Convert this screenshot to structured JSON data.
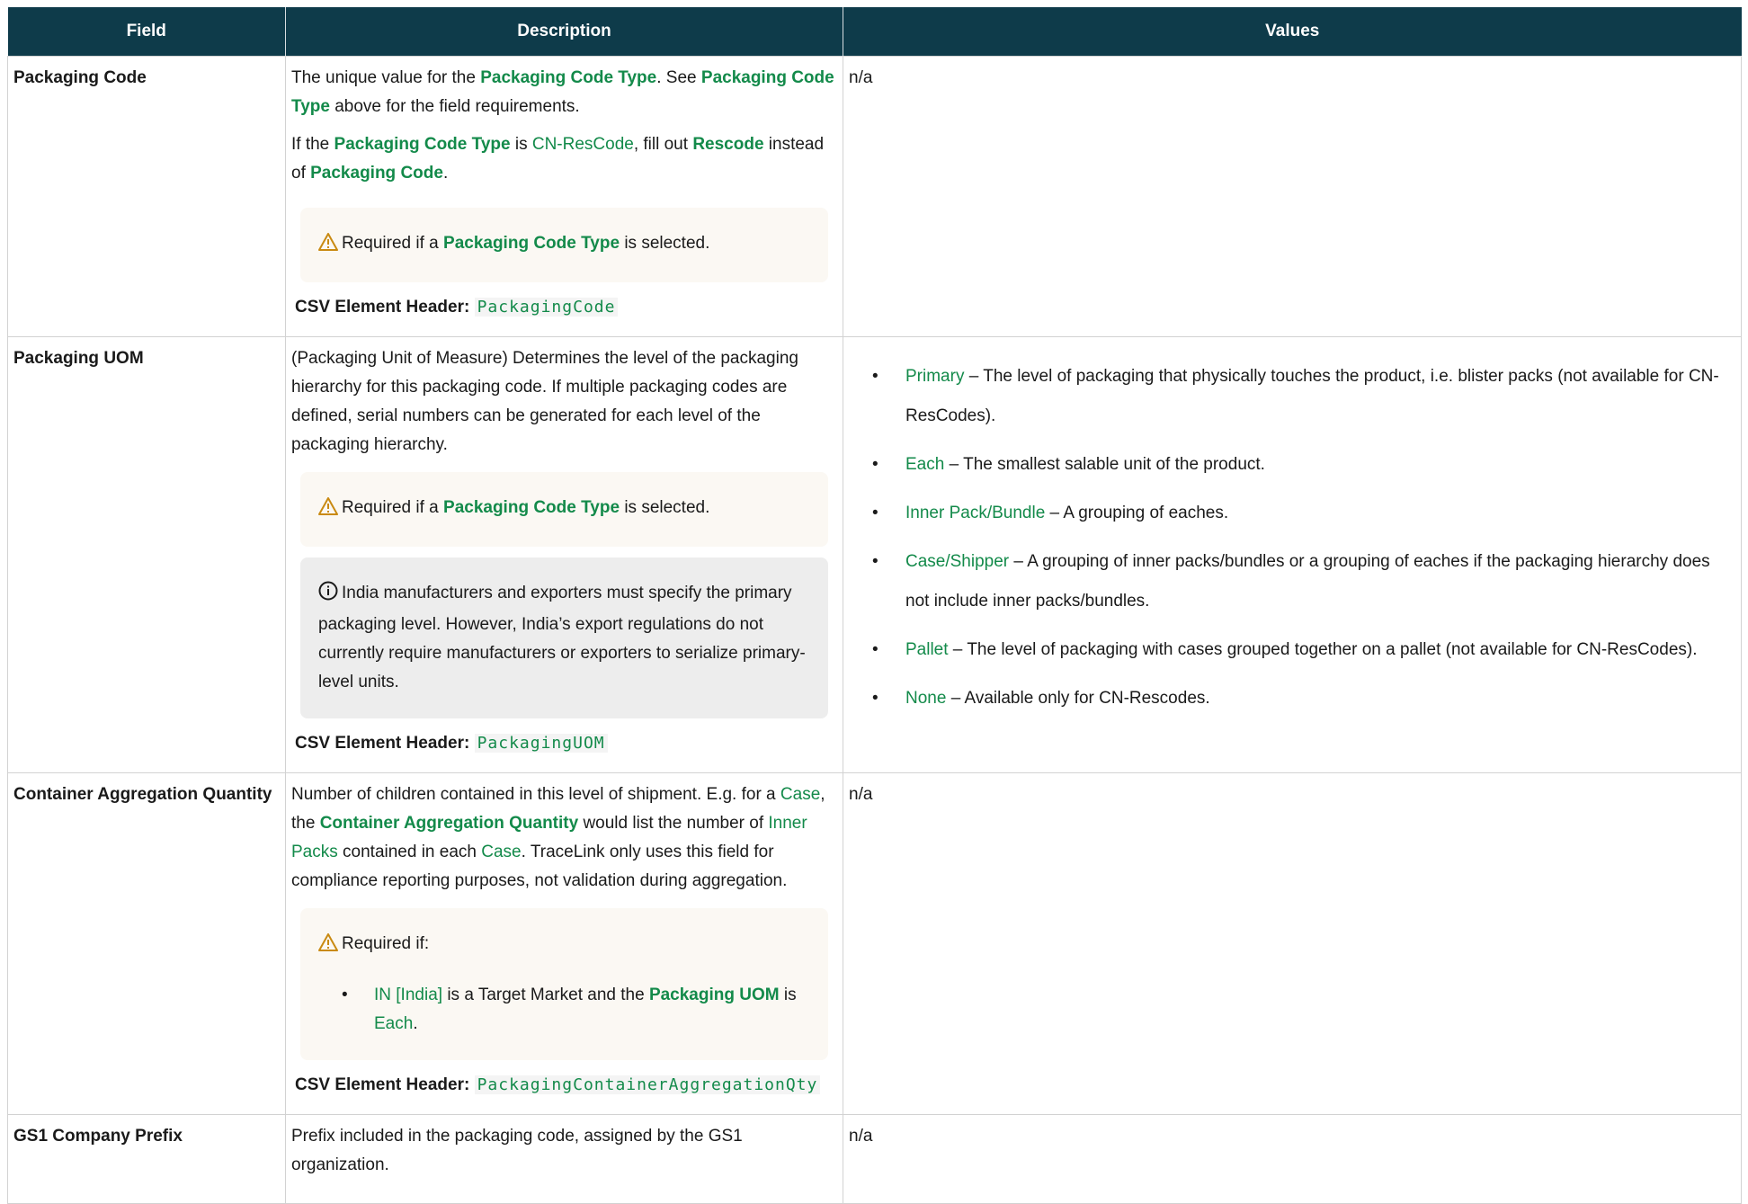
{
  "headers": {
    "field": "Field",
    "description": "Description",
    "values": "Values"
  },
  "rows": [
    {
      "field": "Packaging Code",
      "desc": {
        "p1": {
          "t1": "The unique value for the ",
          "b1": "Packaging Code Type",
          "t2": ". See ",
          "b2": "Packaging Code Type",
          "t3": " above for the field requirements."
        },
        "p2": {
          "t1": "If the ",
          "b1": "Packaging Code Type",
          "t2": " is ",
          "l1": "CN-ResCode",
          "t3": ", fill out ",
          "b2": "Rescode",
          "t4": " instead of ",
          "b3": "Packaging Code",
          "t5": "."
        },
        "warn": {
          "t1": "Required if a ",
          "b1": "Packaging Code Type",
          "t2": " is selected."
        },
        "csv_label": "CSV Element Header:",
        "csv_code": "PackagingCode"
      },
      "values": "n/a"
    },
    {
      "field": "Packaging UOM",
      "desc": {
        "p1": "(Packaging Unit of Measure) Determines the level of the packaging hierarchy for this packaging code. If multiple packaging codes are defined, serial numbers can be generated for each level of the packaging hierarchy.",
        "warn": {
          "t1": "Required if a ",
          "b1": "Packaging Code Type",
          "t2": " is selected."
        },
        "info": "India manufacturers and exporters must specify the primary packaging level. However, India’s export regulations do not currently require manufacturers or exporters to serialize primary-level units.",
        "csv_label": "CSV Element Header:",
        "csv_code": "PackagingUOM"
      },
      "values": [
        {
          "name": "Primary",
          "text": " – The level of packaging that physically touches the product, i.e. blister packs (not available for CN-ResCodes)."
        },
        {
          "name": "Each",
          "text": " – The smallest salable unit of the product."
        },
        {
          "name": "Inner Pack/Bundle",
          "text": " – A grouping of eaches."
        },
        {
          "name": "Case/Shipper",
          "text": " – A grouping of inner packs/bundles or a grouping of eaches if the packaging hierarchy does not include inner packs/bundles."
        },
        {
          "name": "Pallet",
          "text": " – The level of packaging with cases grouped together on a pallet (not available for CN-ResCodes)."
        },
        {
          "name": "None",
          "text": " – Available only for CN-Rescodes."
        }
      ]
    },
    {
      "field": "Container Aggregation Quantity",
      "desc": {
        "p1": {
          "t1": "Number of children contained in this level of shipment. E.g. for a ",
          "l1": "Case",
          "t2": ", the ",
          "b1": "Container Aggregation Quantity",
          "t3": " would list the number of ",
          "l2": "Inner Packs",
          "t4": " contained in each ",
          "l3": "Case",
          "t5": ". TraceLink only uses this field for compliance reporting purposes, not validation during aggregation."
        },
        "warn": {
          "t1": "Required if:",
          "item": {
            "l1": "IN [India]",
            "t1": " is a Target Market and the ",
            "b1": "Packaging UOM",
            "t2": " is ",
            "l2": "Each",
            "t3": "."
          }
        },
        "csv_label": "CSV Element Header:",
        "csv_code": "PackagingContainerAggregationQty"
      },
      "values": "n/a"
    },
    {
      "field": "GS1 Company Prefix",
      "desc": {
        "p1": "Prefix included in the packaging code, assigned by the GS1 organization."
      },
      "values": "n/a"
    }
  ],
  "colors": {
    "header_bg": "#0e3b4a",
    "link_green": "#138a4a",
    "warn_bg": "#fbf8f3",
    "info_bg": "#ededed"
  },
  "icons": {
    "warning": "warning-triangle-icon",
    "info": "info-circle-icon"
  }
}
